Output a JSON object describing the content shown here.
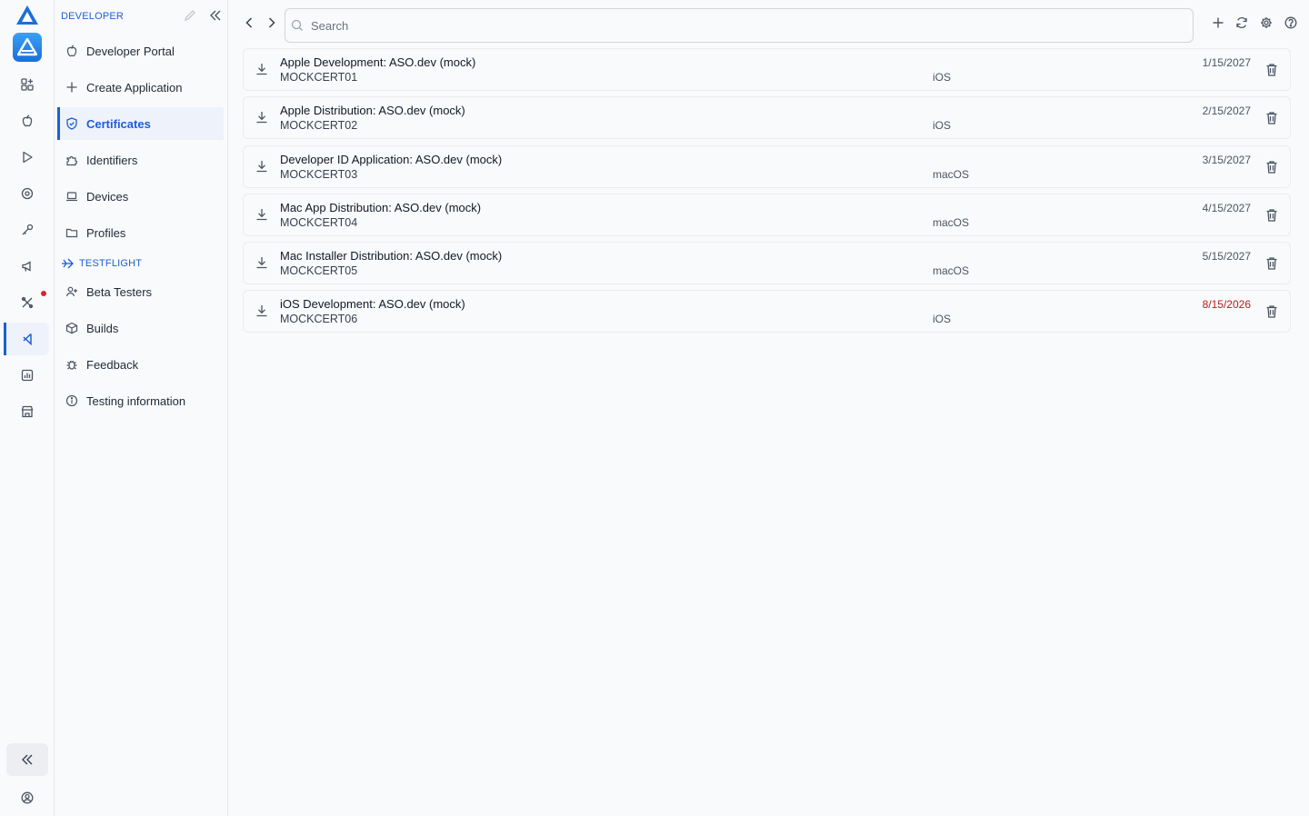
{
  "colors": {
    "accent": "#1d5fd6",
    "danger": "#b91c1c",
    "logo_blue": "#1a6fd8"
  },
  "rail": {
    "items": [
      {
        "icon": "apps-icon"
      },
      {
        "icon": "apple-icon"
      },
      {
        "icon": "play-icon"
      },
      {
        "icon": "eye-icon"
      },
      {
        "icon": "key-icon"
      },
      {
        "icon": "megaphone-icon"
      },
      {
        "icon": "tools-icon"
      },
      {
        "icon": "vscode-icon"
      },
      {
        "icon": "analytics-icon"
      },
      {
        "icon": "store-icon"
      }
    ],
    "active_icon": "vscode-icon"
  },
  "sidebar": {
    "developer_heading": "DEVELOPER",
    "developer_items": [
      {
        "label": "Developer Portal",
        "icon": "apple-icon"
      },
      {
        "label": "Create Application",
        "icon": "plus-icon"
      },
      {
        "label": "Certificates",
        "icon": "shield-icon",
        "active": true
      },
      {
        "label": "Identifiers",
        "icon": "puzzle-icon"
      },
      {
        "label": "Devices",
        "icon": "laptop-icon"
      },
      {
        "label": "Profiles",
        "icon": "folder-icon"
      }
    ],
    "testflight_heading": "TESTFLIGHT",
    "testflight_items": [
      {
        "label": "Beta Testers",
        "icon": "user-plus-icon"
      },
      {
        "label": "Builds",
        "icon": "box-icon"
      },
      {
        "label": "Feedback",
        "icon": "bug-icon"
      },
      {
        "label": "Testing information",
        "icon": "info-icon"
      }
    ]
  },
  "search": {
    "placeholder": "Search",
    "value": ""
  },
  "certificates": [
    {
      "name": "Apple Development: ASO.dev (mock)",
      "serial": "MOCKCERT01",
      "platform": "iOS",
      "expires": "1/15/2027",
      "expiring": false
    },
    {
      "name": "Apple Distribution: ASO.dev (mock)",
      "serial": "MOCKCERT02",
      "platform": "iOS",
      "expires": "2/15/2027",
      "expiring": false
    },
    {
      "name": "Developer ID Application: ASO.dev (mock)",
      "serial": "MOCKCERT03",
      "platform": "macOS",
      "expires": "3/15/2027",
      "expiring": false
    },
    {
      "name": "Mac App Distribution: ASO.dev (mock)",
      "serial": "MOCKCERT04",
      "platform": "macOS",
      "expires": "4/15/2027",
      "expiring": false
    },
    {
      "name": "Mac Installer Distribution: ASO.dev (mock)",
      "serial": "MOCKCERT05",
      "platform": "macOS",
      "expires": "5/15/2027",
      "expiring": false
    },
    {
      "name": "iOS Development: ASO.dev (mock)",
      "serial": "MOCKCERT06",
      "platform": "iOS",
      "expires": "8/15/2026",
      "expiring": true
    }
  ]
}
